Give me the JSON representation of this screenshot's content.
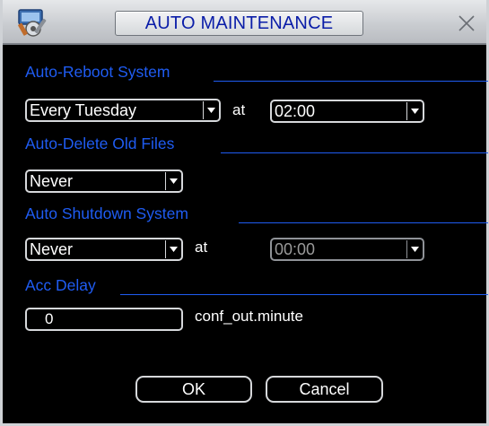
{
  "window": {
    "title": "AUTO MAINTENANCE",
    "app_icon": "settings-tools-icon",
    "close_icon": "close-icon"
  },
  "sections": {
    "reboot": "Auto-Reboot System",
    "delete_files": "Auto-Delete Old Files",
    "shutdown": "Auto Shutdown System",
    "acc_delay": "Acc Delay"
  },
  "reboot": {
    "day_value": "Every Tuesday",
    "at_label": "at",
    "time_value": "02:00"
  },
  "delete_files": {
    "value": "Never"
  },
  "shutdown": {
    "day_value": "Never",
    "at_label": "at",
    "time_value": "00:00"
  },
  "acc_delay": {
    "value": "0",
    "unit_label": "conf_out.minute"
  },
  "buttons": {
    "ok": "OK",
    "cancel": "Cancel"
  },
  "colors": {
    "title_text": "#0a1da8",
    "section_text": "#1f5cf2",
    "background": "#000000"
  }
}
